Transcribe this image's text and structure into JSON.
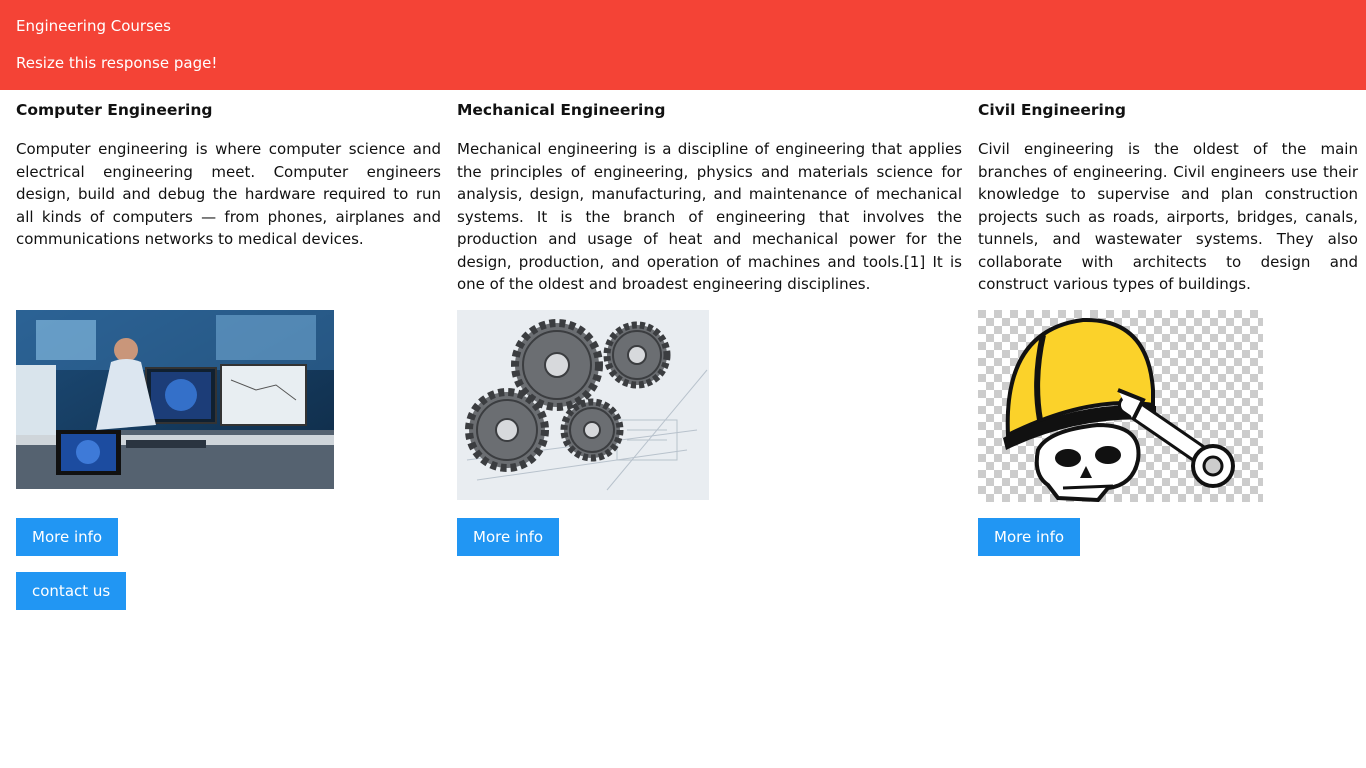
{
  "header": {
    "title": "Engineering Courses",
    "subtitle": "Resize this response page!"
  },
  "columns": [
    {
      "heading": "Computer Engineering",
      "description": "Computer engineering is where computer science and electrical engineering meet. Computer engineers design, build and debug the hardware required to run all kinds of computers — from phones, airplanes and communications networks to medical devices.",
      "image": "computer-engineer-workstation",
      "button_label": "More info"
    },
    {
      "heading": "Mechanical Engineering",
      "description": "Mechanical engineering is a discipline of engineering that applies the principles of engineering, physics and materials science for analysis, design, manufacturing, and maintenance of mechanical systems. It is the branch of engineering that involves the production and usage of heat and mechanical power for the design, production, and operation of machines and tools.[1] It is one of the oldest and broadest engineering disciplines.",
      "image": "gears-on-blueprint",
      "button_label": "More info"
    },
    {
      "heading": "Civil Engineering",
      "description": "Civil engineering is the oldest of the main branches of engineering. Civil engineers use their knowledge to supervise and plan construction projects such as roads, airports, bridges, canals, tunnels, and wastewater systems. They also collaborate with architects to design and construct various types of buildings.",
      "image": "skull-hardhat-wrench",
      "button_label": "More info"
    }
  ],
  "contact_label": "contact us",
  "colors": {
    "header_bg": "#f44336",
    "button_bg": "#2196f3"
  }
}
